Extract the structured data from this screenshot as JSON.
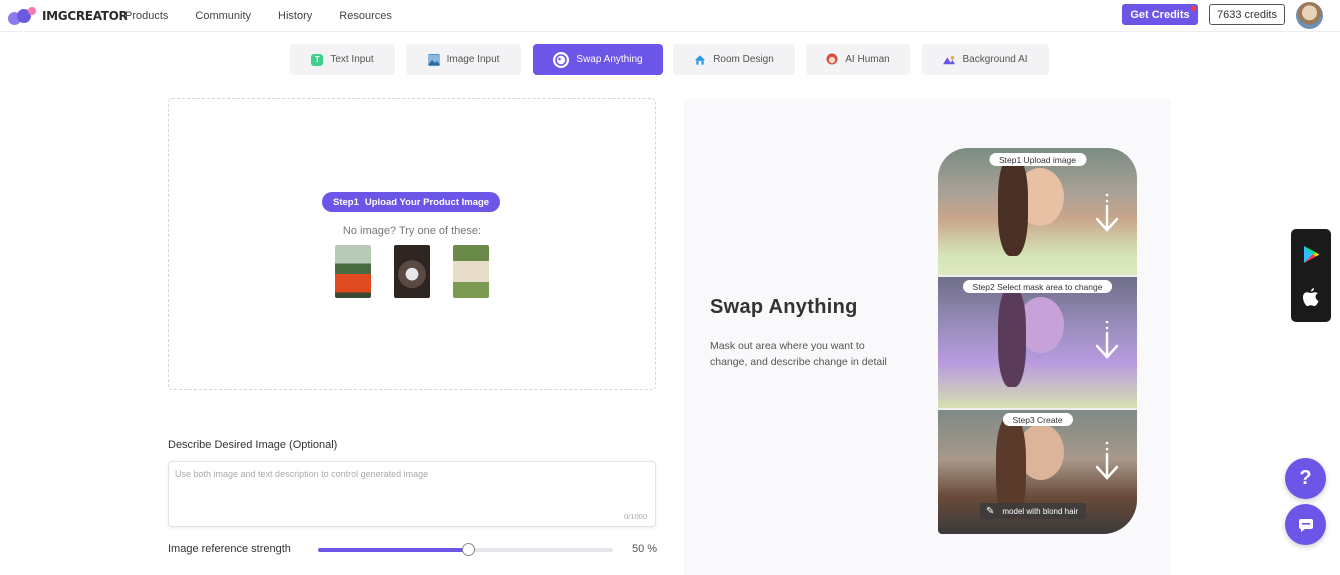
{
  "header": {
    "logo_text": "IMGCREATOR",
    "nav": [
      "Products",
      "Community",
      "History",
      "Resources"
    ],
    "get_credits_label": "Get Credits",
    "credits_text": "7633 credits"
  },
  "tabs": [
    {
      "label": "Text Input",
      "icon": "text-input-icon",
      "color": "#3fcf8e"
    },
    {
      "label": "Image Input",
      "icon": "image-input-icon",
      "color": "#4a90c8"
    },
    {
      "label": "Swap Anything",
      "icon": "swap-anything-icon",
      "color": "#ffffff",
      "active": true
    },
    {
      "label": "Room Design",
      "icon": "room-design-icon",
      "color": "#2f9be0"
    },
    {
      "label": "AI Human",
      "icon": "ai-human-icon",
      "color": "#d94a3a"
    },
    {
      "label": "Background AI",
      "icon": "background-ai-icon",
      "color": "#6b56e8"
    }
  ],
  "upload": {
    "step_prefix": "Step1",
    "step_text": "Upload Your Product Image",
    "try_text": "No image? Try one of these:"
  },
  "description": {
    "label": "Describe Desired Image (Optional)",
    "placeholder": "Use both image and text description to control generated image",
    "counter": "0/1000"
  },
  "strength": {
    "label": "Image reference strength",
    "value": 50,
    "value_text": "50 %"
  },
  "panel": {
    "title": "Swap Anything",
    "description": "Mask out area where you want to change, and describe change in detail",
    "steps": [
      "Step1  Upload image",
      "Step2  Select mask area to change",
      "Step3  Create"
    ],
    "caption": "model with blond hair"
  },
  "colors": {
    "accent": "#6b56e8"
  }
}
